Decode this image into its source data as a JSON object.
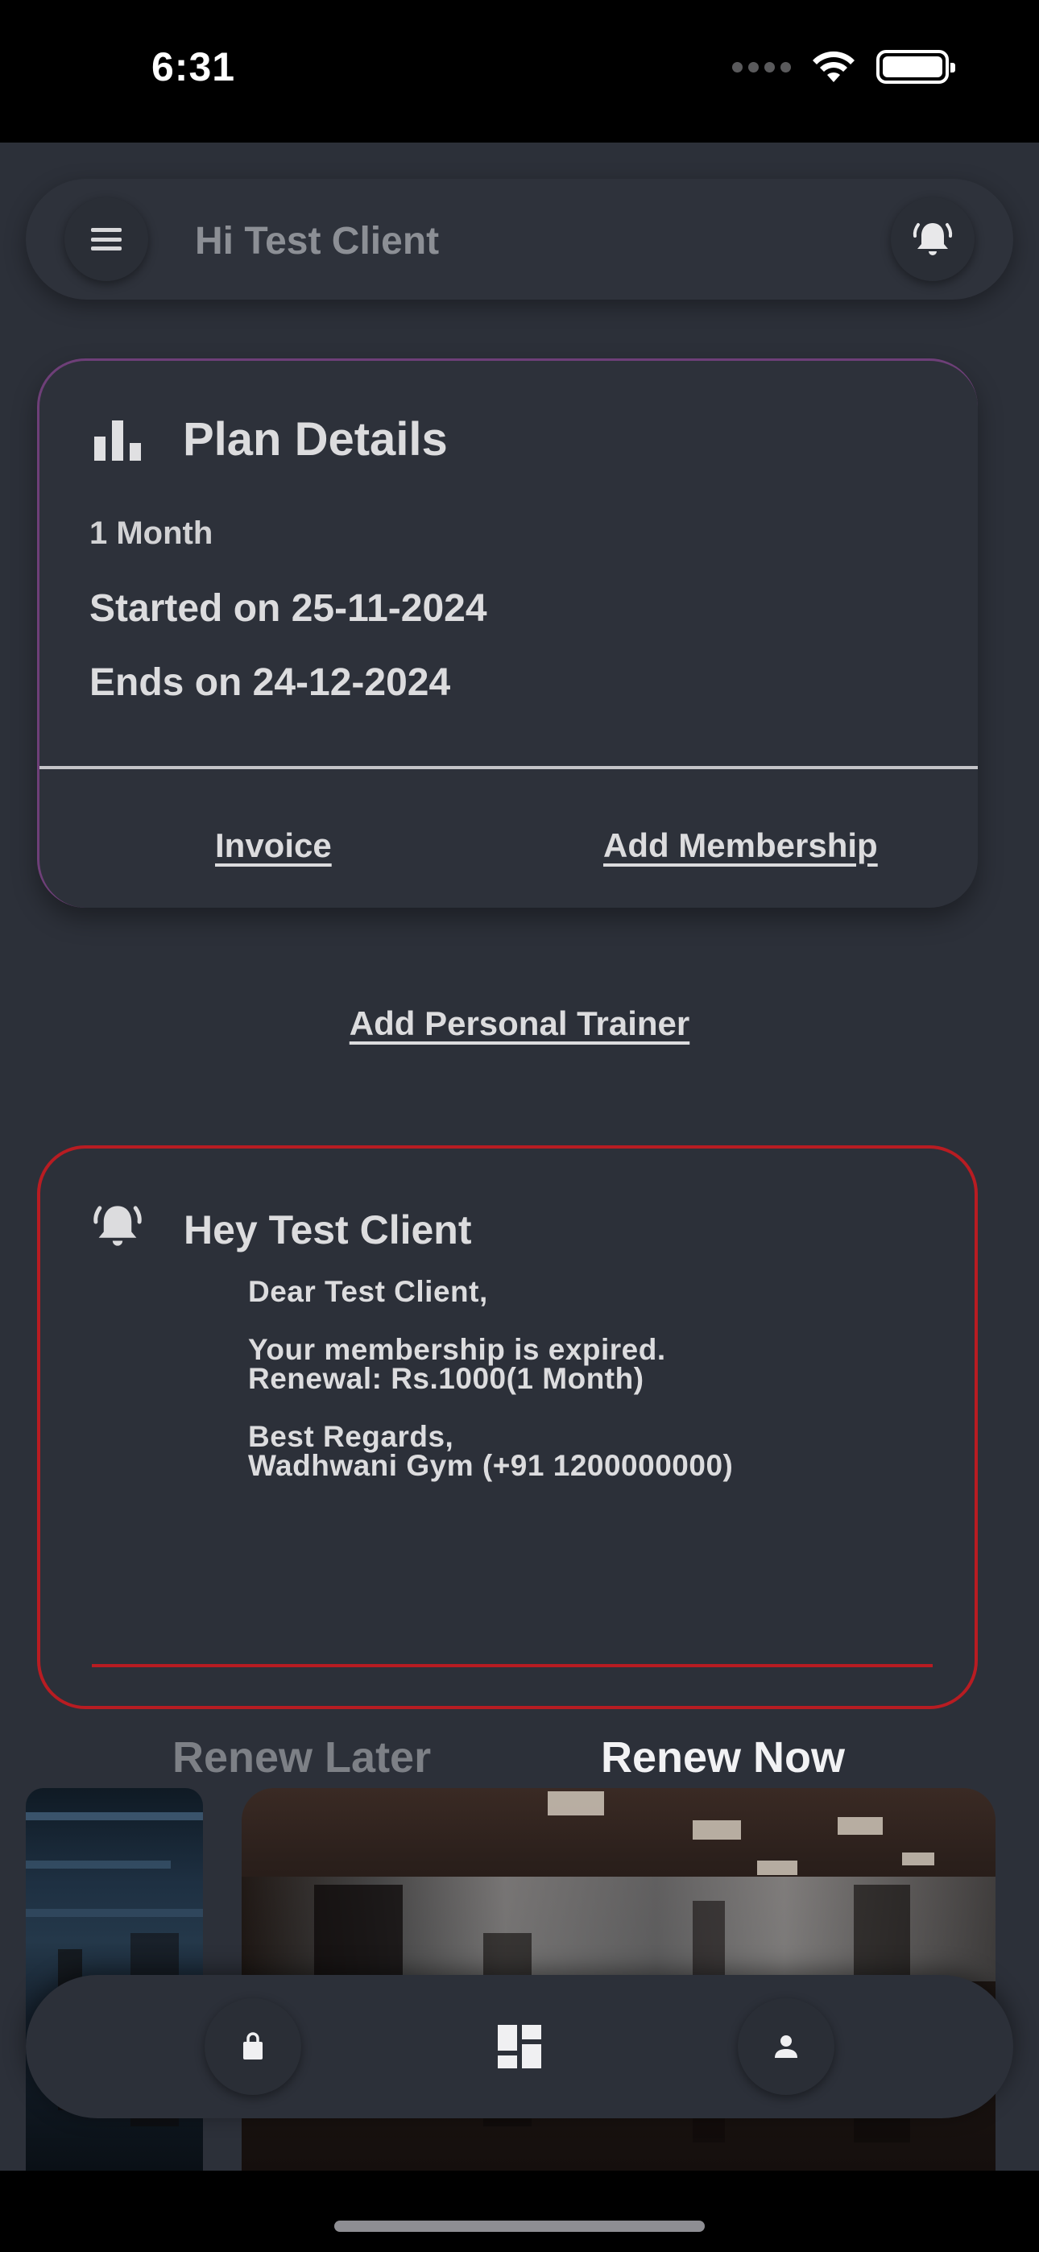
{
  "status_bar": {
    "time": "6:31"
  },
  "app_bar": {
    "greeting": "Hi Test Client"
  },
  "plan": {
    "title": "Plan Details",
    "duration": "1 Month",
    "started": "Started on 25-11-2024",
    "ends": "Ends on 24-12-2024",
    "invoice_label": "Invoice",
    "add_membership_label": "Add Membership"
  },
  "add_trainer_label": "Add Personal Trainer",
  "alert": {
    "title": "Hey Test Client",
    "body": "Dear Test Client,\n\nYour membership is expired.\nRenewal: Rs.1000(1 Month)\n\nBest Regards,\nWadhwani Gym (+91 1200000000)",
    "renew_later_label": "Renew Later",
    "renew_now_label": "Renew Now",
    "accent_color": "#b81c22"
  },
  "gallery": {
    "icons": [
      "gym-photo",
      "gym-photo"
    ]
  },
  "bottom_nav": {
    "icons": [
      "shopping-bag-icon",
      "dashboard-icon",
      "person-icon"
    ]
  },
  "colors": {
    "background": "#2c3039",
    "plan_accent": "#6e3f78"
  }
}
